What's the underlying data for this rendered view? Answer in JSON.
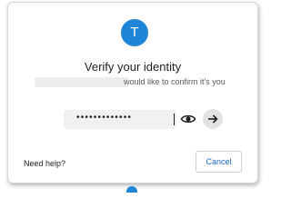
{
  "dialog": {
    "avatar_initial": "T",
    "title": "Verify your identity",
    "subtitle": "would like to confirm it's you",
    "password": {
      "masked_value": "•••••••••••••"
    },
    "help_link": "Need help?",
    "cancel_label": "Cancel"
  },
  "icons": {
    "show_password": "eye-icon",
    "submit": "arrow-right-icon"
  },
  "colors": {
    "accent": "#1f86d7",
    "link": "#1a67c8"
  }
}
